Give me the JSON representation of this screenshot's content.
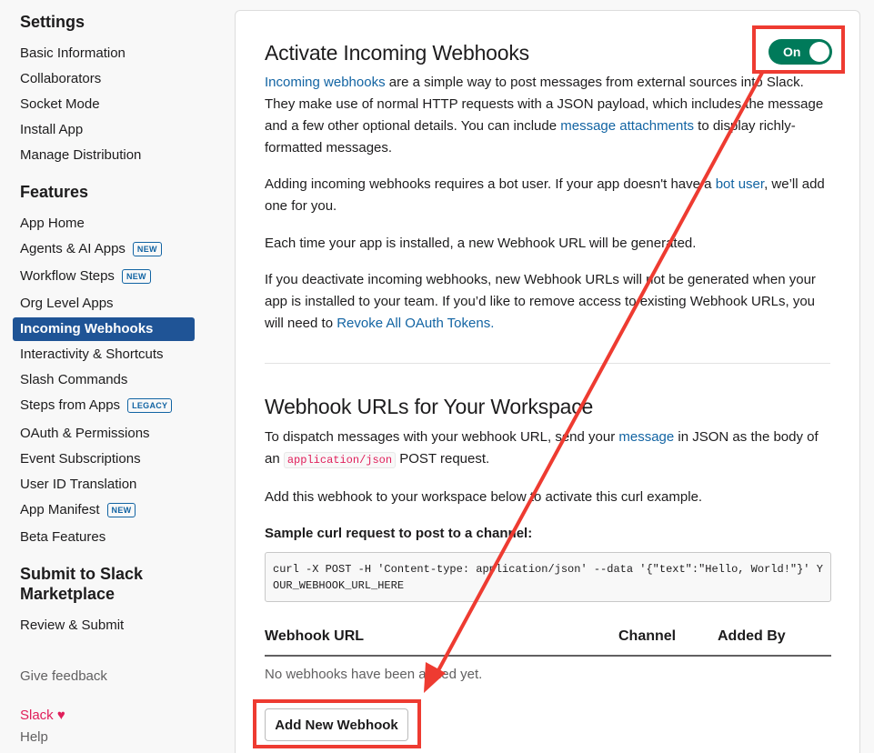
{
  "sidebar": {
    "settings_heading": "Settings",
    "settings_items": [
      "Basic Information",
      "Collaborators",
      "Socket Mode",
      "Install App",
      "Manage Distribution"
    ],
    "features_heading": "Features",
    "features_items": [
      {
        "label": "App Home"
      },
      {
        "label": "Agents & AI Apps",
        "badge": "NEW"
      },
      {
        "label": "Workflow Steps",
        "badge": "NEW"
      },
      {
        "label": "Org Level Apps"
      },
      {
        "label": "Incoming Webhooks",
        "active": true
      },
      {
        "label": "Interactivity & Shortcuts"
      },
      {
        "label": "Slash Commands"
      },
      {
        "label": "Steps from Apps",
        "badge": "LEGACY"
      },
      {
        "label": "OAuth & Permissions"
      },
      {
        "label": "Event Subscriptions"
      },
      {
        "label": "User ID Translation"
      },
      {
        "label": "App Manifest",
        "badge": "NEW"
      },
      {
        "label": "Beta Features"
      }
    ],
    "submit_heading_line1": "Submit to Slack",
    "submit_heading_line2": "Marketplace",
    "submit_items": [
      "Review & Submit"
    ],
    "give_feedback": "Give feedback",
    "slack_label": "Slack",
    "heart": "♥",
    "help": "Help"
  },
  "main": {
    "activate_title": "Activate Incoming Webhooks",
    "toggle_label": "On",
    "intro": {
      "link1": "Incoming webhooks",
      "text1": " are a simple way to post messages from external sources into Slack. They make use of normal HTTP requests with a JSON payload, which includes the message and a few other optional details. You can include ",
      "link2": "message attachments",
      "text2": " to display richly-formatted messages."
    },
    "bot_para": {
      "text1": "Adding incoming webhooks requires a bot user. If your app doesn't have a ",
      "link": "bot user",
      "text2": ", we’ll add one for you."
    },
    "install_para": "Each time your app is installed, a new Webhook URL will be generated.",
    "deactivate_para": {
      "text1": "If you deactivate incoming webhooks, new Webhook URLs will not be generated when your app is installed to your team. If you’d like to remove access to existing Webhook URLs, you will need to ",
      "link": "Revoke All OAuth Tokens."
    },
    "urls_title": "Webhook URLs for Your Workspace",
    "dispatch_para": {
      "text1": "To dispatch messages with your webhook URL, send your ",
      "link": "message",
      "text2": " in JSON as the body of an ",
      "code": "application/json",
      "text3": " POST request."
    },
    "add_para": "Add this webhook to your workspace below to activate this curl example.",
    "sample_label": "Sample curl request to post to a channel:",
    "curl_code": "curl -X POST -H 'Content-type: application/json' --data '{\"text\":\"Hello, World!\"}' YOUR_WEBHOOK_URL_HERE",
    "table": {
      "col_url": "Webhook URL",
      "col_channel": "Channel",
      "col_added_by": "Added By",
      "empty": "No webhooks have been added yet."
    },
    "add_button": "Add New Webhook"
  },
  "colors": {
    "accent": "#1264a3",
    "active_nav": "#1f5496",
    "toggle_on": "#007a5a",
    "annotation": "#ee3b31"
  }
}
